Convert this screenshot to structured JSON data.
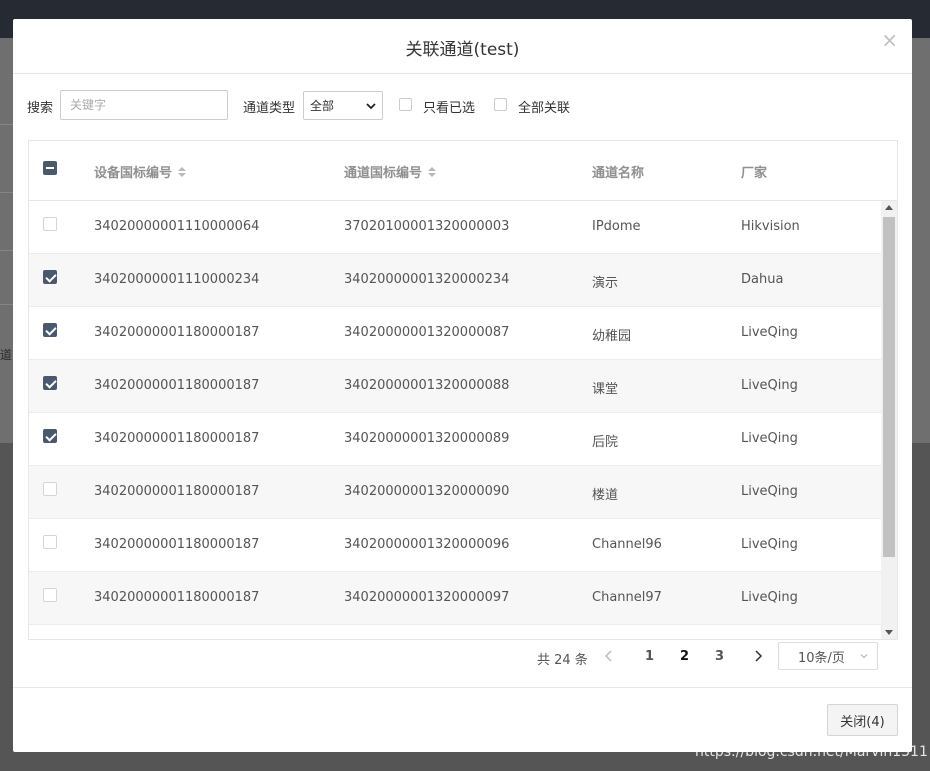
{
  "dialog": {
    "title": "关联通道(test)",
    "close_symbol": "×"
  },
  "toolbar": {
    "search_label": "搜索",
    "search_placeholder": "关键字",
    "type_label": "通道类型",
    "type_selected": "全部",
    "only_selected_label": "只看已选",
    "link_all_label": "全部关联"
  },
  "table": {
    "columns": [
      "设备国标编号",
      "通道国标编号",
      "通道名称",
      "厂家"
    ],
    "rows": [
      {
        "checked": false,
        "device_id": "34020000001110000064",
        "channel_id": "37020100001320000003",
        "name": "IPdome",
        "vendor": "Hikvision"
      },
      {
        "checked": true,
        "device_id": "34020000001110000234",
        "channel_id": "34020000001320000234",
        "name": "演示",
        "vendor": "Dahua"
      },
      {
        "checked": true,
        "device_id": "34020000001180000187",
        "channel_id": "34020000001320000087",
        "name": "幼稚园",
        "vendor": "LiveQing"
      },
      {
        "checked": true,
        "device_id": "34020000001180000187",
        "channel_id": "34020000001320000088",
        "name": "课堂",
        "vendor": "LiveQing"
      },
      {
        "checked": true,
        "device_id": "34020000001180000187",
        "channel_id": "34020000001320000089",
        "name": "后院",
        "vendor": "LiveQing"
      },
      {
        "checked": false,
        "device_id": "34020000001180000187",
        "channel_id": "34020000001320000090",
        "name": "楼道",
        "vendor": "LiveQing"
      },
      {
        "checked": false,
        "device_id": "34020000001180000187",
        "channel_id": "34020000001320000096",
        "name": "Channel96",
        "vendor": "LiveQing"
      },
      {
        "checked": false,
        "device_id": "34020000001180000187",
        "channel_id": "34020000001320000097",
        "name": "Channel97",
        "vendor": "LiveQing"
      }
    ]
  },
  "pagination": {
    "total_text": "共 24 条",
    "pages": [
      "1",
      "2",
      "3"
    ],
    "current_page": "2",
    "page_size": "10条/页"
  },
  "footer": {
    "close_button": "关闭(4)"
  },
  "watermark": "https://blog.csdn.net/Marvin1311",
  "background": {
    "fragment": "道"
  },
  "colors": {
    "checkbox_checked": "#4a5a6e",
    "topbar": "#262b33",
    "scrollbar_thumb": "#c1c1c1"
  }
}
